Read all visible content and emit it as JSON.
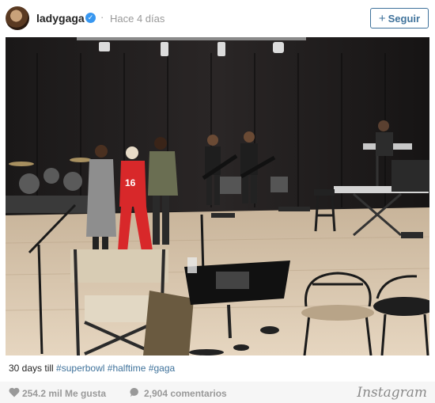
{
  "post": {
    "username": "ladygaga",
    "verified_mark": "✓",
    "separator": "·",
    "time_ago": "Hace 4 días",
    "follow_label": "Seguir",
    "follow_plus": "+"
  },
  "caption": {
    "text": "30 days till",
    "hashtags": [
      "#superbowl",
      "#halftime",
      "#gaga"
    ]
  },
  "stats": {
    "likes": "254.2 mil Me gusta",
    "comments": "2,904 comentarios"
  },
  "brand": "Instagram",
  "photo": {
    "jersey_number": "16"
  },
  "colors": {
    "link": "#3f729b",
    "verified": "#3897f0",
    "muted": "#999999"
  },
  "icons": [
    "verified-icon",
    "plus-icon",
    "heart-icon",
    "comment-icon"
  ]
}
